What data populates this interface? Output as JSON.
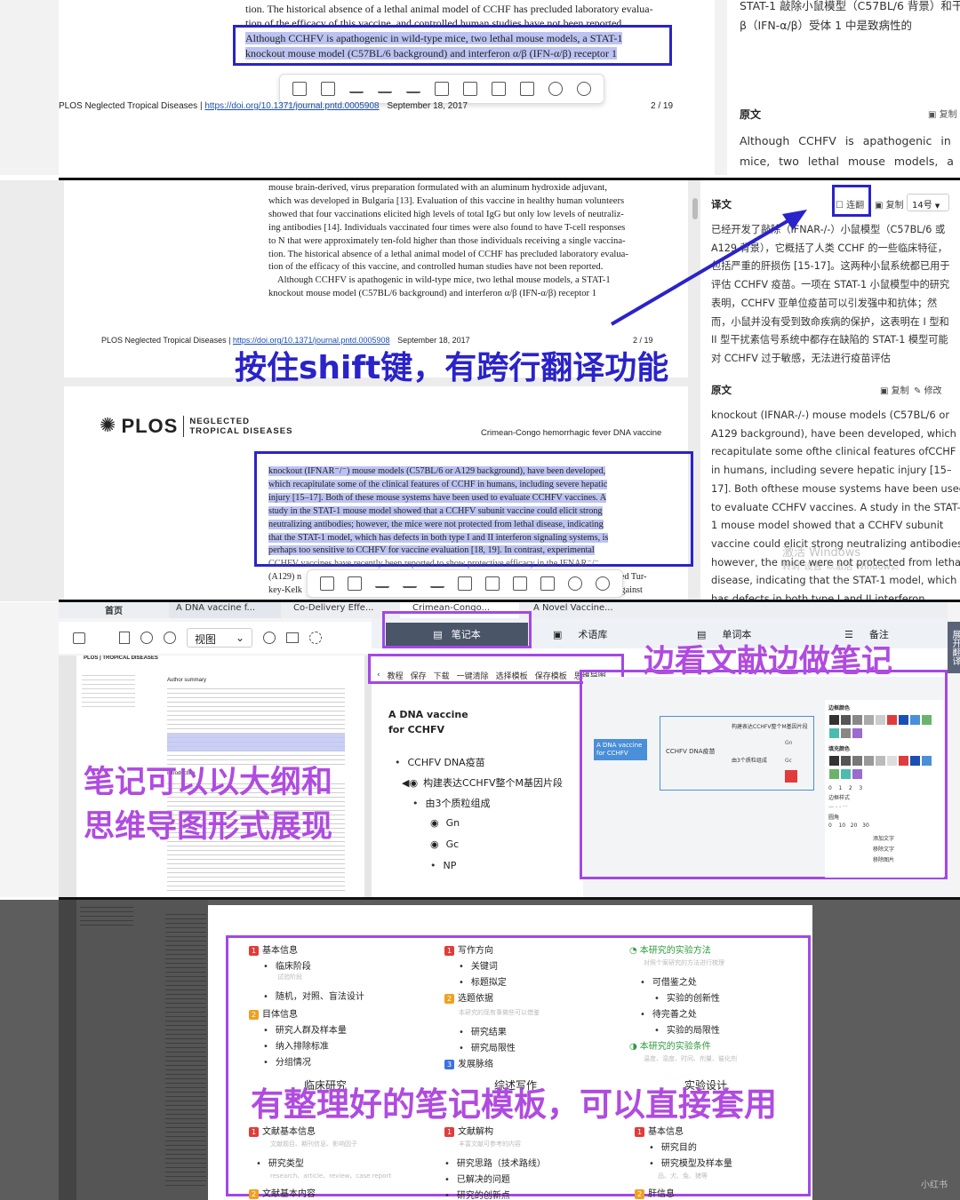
{
  "p1": {
    "text_top1": "tion. The historical absence of a lethal animal model of CCHF has precluded laboratory evalua-",
    "text_top2": "tion of the efficacy of this vaccine, and controlled human studies have not been reported.",
    "sel1": "Although CCHFV is apathogenic in wild-type mice, two lethal mouse models, a STAT-1",
    "sel2": "knockout mouse model (C57BL/6 background) and interferon α/β (IFN-α/β) receptor 1",
    "footer_journal": "PLOS Neglected Tropical Diseases |",
    "footer_doi": "https://doi.org/10.1371/journal.pntd.0005908",
    "footer_date": "September 18, 2017",
    "footer_page": "2 / 19",
    "right_line1": "STAT-1 敲除小鼠模型（C57BL/6 背景）和干",
    "right_line2": "β（IFN-α/β）受体 1 中是致病性的",
    "orig_label": "原文",
    "copy_label": "复制",
    "orig_line1": "Although CCHFV is apathogenic in w",
    "orig_line2": "mice, two lethal mouse models, a"
  },
  "p2": {
    "body": [
      "mouse brain-derived, virus preparation formulated with an aluminum hydroxide adjuvant,",
      "which was developed in Bulgaria [13]. Evaluation of this vaccine in healthy human volunteers",
      "showed that four vaccinations elicited high levels of total IgG but only low levels of neutraliz-",
      "ing antibodies [14]. Individuals vaccinated four times were also found to have T-cell responses",
      "to N that were approximately ten-fold higher than those individuals receiving a single vaccina-",
      "tion. The historical absence of a lethal animal model of CCHF has precluded laboratory evalua-",
      "tion of the efficacy of this vaccine, and controlled human studies have not been reported.",
      "    Although CCHFV is apathogenic in wild-type mice, two lethal mouse models, a STAT-1",
      "knockout mouse model (C57BL/6 background) and interferon α/β (IFN-α/β) receptor 1"
    ],
    "footer_journal": "PLOS Neglected Tropical Diseases |",
    "footer_doi": "https://doi.org/10.1371/journal.pntd.0005908",
    "footer_date": "September 18, 2017",
    "footer_page": "2 / 19",
    "caption": "按住shift键，有跨行翻译功能",
    "plos_logo": "PLOS",
    "plos_sub1": "NEGLECTED",
    "plos_sub2": "TROPICAL DISEASES",
    "running_head": "Crimean-Congo hemorrhagic fever DNA vaccine",
    "sel": [
      "knockout (IFNAR⁻/⁻) mouse models (C57BL/6 or A129 background), have been developed,",
      "which recapitulate some of the clinical features of CCHF in humans, including severe hepatic",
      "injury [15–17]. Both of these mouse systems have been used to evaluate CCHFV vaccines. A",
      "study in the STAT-1 mouse model showed that a CCHFV subunit vaccine could elicit strong",
      "neutralizing antibodies; however, the mice were not protected from lethal disease, indicating",
      "that the STAT-1 model, which has defects in both type I and II interferon signaling systems, is",
      "perhaps too sensitive to CCHFV for vaccine evaluation [18, 19]. In contrast, experimental"
    ],
    "tail1": "CCHFV vaccines have recently been reported to show protective efficacy in the IFNAR⁻/⁻",
    "tail2a": "(A129) n",
    "tail2b": "ived Tur-",
    "tail3a": "key-Kelk",
    "tail3b": "against",
    "trans_label": "译文",
    "lianfan": "连翻",
    "copy": "复制",
    "fontsize": "14号",
    "trans": [
      "已经开发了敲除（IFNAR-/-）小鼠模型（C57BL/6 或",
      "A129 背景），它概括了人类 CCHF 的一些临床特征，",
      "包括严重的肝损伤 [15-17]。这两种小鼠系统都已用于",
      "评估 CCHFV 疫苗。一项在 STAT-1 小鼠模型中的研究",
      "表明，CCHFV 亚单位疫苗可以引发强中和抗体；然",
      "而，小鼠并没有受到致命疾病的保护，这表明在 I 型和",
      "II 型干扰素信号系统中都存在缺陷的 STAT-1 模型可能",
      "对 CCHFV 过于敏感，无法进行疫苗评估"
    ],
    "orig_label": "原文",
    "edit": "修改",
    "orig": [
      "knockout (IFNAR-/-) mouse models (C57BL/6 or",
      "A129 background), have been developed, which",
      "recapitulate some ofthe clinical features ofCCHF",
      "in humans, including severe hepatic injury [15–",
      "17]. Both ofthese mouse systems have been used",
      "to evaluate CCHFV vaccines. A study in the STAT-",
      "1 mouse model showed that a CCHFV subunit",
      "vaccine could elicit strong neutralizing antibodies;",
      "however, the mice were not protected from lethal",
      "disease, indicating that the STAT-1 model, which",
      "has defects in both type I and II interferon"
    ],
    "watermark1": "激活 Windows",
    "watermark2": "转到\"设置\"以激活 Windows。"
  },
  "p3": {
    "tabs": [
      "首页",
      "A DNA vaccine f...",
      "Co-Delivery Effe...",
      "Crimean-Congo...",
      "A Novel Vaccine..."
    ],
    "view_label": "视图",
    "notebook_btn": "笔记本",
    "term_lib": "术语库",
    "vocab": "单词本",
    "memo": "备注",
    "expand_tr": "展开翻译",
    "caption_tr": "边看文献边做笔记",
    "note_toolbar": [
      "教程",
      "保存",
      "下载",
      "一键清除",
      "选择模板",
      "保存模板",
      "思维导图"
    ],
    "note_title1": "A DNA vaccine",
    "note_title2": "for CCHFV",
    "outline": [
      "CCHFV DNA疫苗",
      "构建表达CCHFV整个M基因片段",
      "由3个质粒组成",
      "Gn",
      "Gc",
      "NP"
    ],
    "caption_left1": "笔记可以以大纲和",
    "caption_left2": "思维导图形式展现",
    "mm_root": "A DNA vaccine for CCHFV",
    "mm_n1": "CCHFV DNA疫苗",
    "mm_n2": "构建表达CCHFV整个M基因片段",
    "mm_n3": "由3个质粒组成",
    "mm_gn": "Gn",
    "mm_gc": "Gc",
    "border_color": "边框颜色",
    "fill_color": "填充颜色",
    "border_width_nums": "0    1    2    3",
    "border_style": "边框样式",
    "radius": "圆角",
    "radius_nums": "0    10   20   30",
    "add_text": "添加文字",
    "remove_text": "移除文字",
    "remove_img": "移除图片",
    "pdf_head": "PLOS | TROPICAL DISEASES",
    "author_summary": "Author summary",
    "introduction": "Introduction"
  },
  "p4": {
    "col1": {
      "sec1": "基本信息",
      "items1": [
        "临床阶段",
        "随机，对照、盲法设计"
      ],
      "sub1": "试验阶段",
      "sec2": "目体信息",
      "items2": [
        "研究人群及样本量",
        "纳入排除标准",
        "分组情况"
      ],
      "footer": "临床研究",
      "sec3": "文献基本信息",
      "sub3": "文献题目、期刊信息、影响因子",
      "item3": "研究类型",
      "sub3b": "research、article、review、case report",
      "sec4": "文献基本内容"
    },
    "col2": {
      "sec1": "写作方向",
      "items1": [
        "关键词",
        "标题拟定"
      ],
      "sec2": "选题依据",
      "sub2": "本研究的现有事做些可以借鉴",
      "items2": [
        "研究结果",
        "研究局限性"
      ],
      "sec3": "发展脉络",
      "footer": "综述写作",
      "sec4": "文献解构",
      "sub4": "丰富文献可参考的内容",
      "items4": [
        "研究思路（技术路线）",
        "已解决的问题",
        "研究的创新点"
      ]
    },
    "col3": {
      "sec1": "本研究的实验方法",
      "sub1": "对照个案研究的方法进行梳理",
      "items1": [
        "可借鉴之处",
        "实验的创新性",
        "待完善之处",
        "实验的局限性"
      ],
      "sec2": "本研究的实验条件",
      "sub2": "温度、湿度、时间、剂量、催化剂",
      "footer": "实验设计",
      "sec3": "基本信息",
      "items3": [
        "研究目的",
        "研究模型及样本量"
      ],
      "sub3": "品、犬、兔、猪等",
      "sec4": "肝信息"
    },
    "caption": "有整理好的笔记模板，可以直接套用",
    "corner": "小红书"
  },
  "colors": {
    "blue_box": "#2a23c9",
    "purple_box": "#a347e8",
    "caption_blue": "#2a23c9",
    "caption_purple": "#b04be0",
    "highlight": "#bcc3f2"
  }
}
